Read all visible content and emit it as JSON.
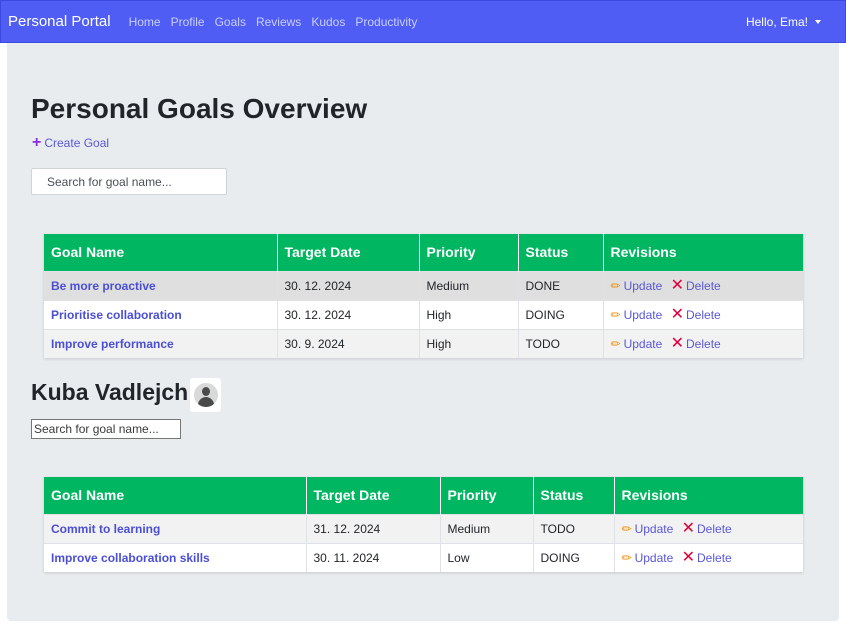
{
  "navbar": {
    "brand": "Personal Portal",
    "links": [
      "Home",
      "Profile",
      "Goals",
      "Reviews",
      "Kudos",
      "Productivity"
    ],
    "user_greeting": "Hello, Ema!"
  },
  "page": {
    "title": "Personal Goals Overview",
    "create_goal_label": "Create Goal",
    "search_placeholder": "Search for goal name..."
  },
  "columns": [
    "Goal Name",
    "Target Date",
    "Priority",
    "Status",
    "Revisions"
  ],
  "actions": {
    "update": "Update",
    "delete": "Delete"
  },
  "my_goals": [
    {
      "name": "Be more proactive",
      "date": "30. 12. 2024",
      "priority": "Medium",
      "status": "DONE"
    },
    {
      "name": "Prioritise collaboration",
      "date": "30. 12. 2024",
      "priority": "High",
      "status": "DOING"
    },
    {
      "name": "Improve performance",
      "date": "30. 9. 2024",
      "priority": "High",
      "status": "TODO"
    }
  ],
  "subordinate": {
    "name": "Kuba Vadlejch",
    "search_placeholder": "Search for goal name...",
    "goals": [
      {
        "name": "Commit to learning",
        "date": "31. 12. 2024",
        "priority": "Medium",
        "status": "TODO"
      },
      {
        "name": "Improve collaboration skills",
        "date": "30. 11. 2024",
        "priority": "Low",
        "status": "DOING"
      }
    ]
  },
  "colors": {
    "navbar": "#4f5df5",
    "table_header": "#00b661",
    "link": "#4a4fd4",
    "update_icon": "#f28c00",
    "delete_icon": "#e0003c",
    "create_icon": "#8a2be2"
  },
  "icons": {
    "create": "plus-icon",
    "update": "pencil-icon",
    "delete": "x-mark-icon",
    "avatar": "user-avatar-icon",
    "user_menu": "caret-down-icon"
  }
}
